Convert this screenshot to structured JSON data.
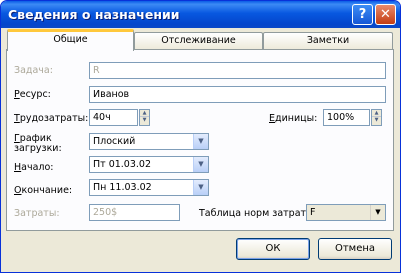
{
  "window": {
    "title": "Сведения о назначении",
    "help_label": "?",
    "close_label": "✕"
  },
  "tabs": [
    {
      "label": "Общие",
      "active": true
    },
    {
      "label": "Отслеживание",
      "active": false
    },
    {
      "label": "Заметки",
      "active": false
    }
  ],
  "form": {
    "task": {
      "label": "Задача:",
      "value": "R"
    },
    "resource": {
      "label_underline": "Р",
      "label_rest": "есурс:",
      "value": "Иванов"
    },
    "work": {
      "label_underline": "Т",
      "label_rest": "рудозатраты:",
      "value": "40ч"
    },
    "units": {
      "label_underline": "Е",
      "label_rest": "диницы:",
      "value": "100%"
    },
    "work_contour": {
      "label_line1_underline": "Г",
      "label_line1_rest": "рафик",
      "label_line2": "загрузки:",
      "value": "Плоский"
    },
    "start": {
      "label_underline": "Н",
      "label_rest": "ачало:",
      "value": "Пт 01.03.02"
    },
    "finish": {
      "label_underline": "О",
      "label_rest": "кончание:",
      "value": "Пн 11.03.02"
    },
    "cost": {
      "label": "Затраты:",
      "value": "250$"
    },
    "cost_rate_table": {
      "label": "Таблица норм затрат:",
      "value": "F"
    }
  },
  "buttons": {
    "ok": "ОК",
    "cancel": "Отмена"
  },
  "icons": {
    "spin_up": "▲",
    "spin_down": "▼",
    "dropdown": "▼"
  }
}
